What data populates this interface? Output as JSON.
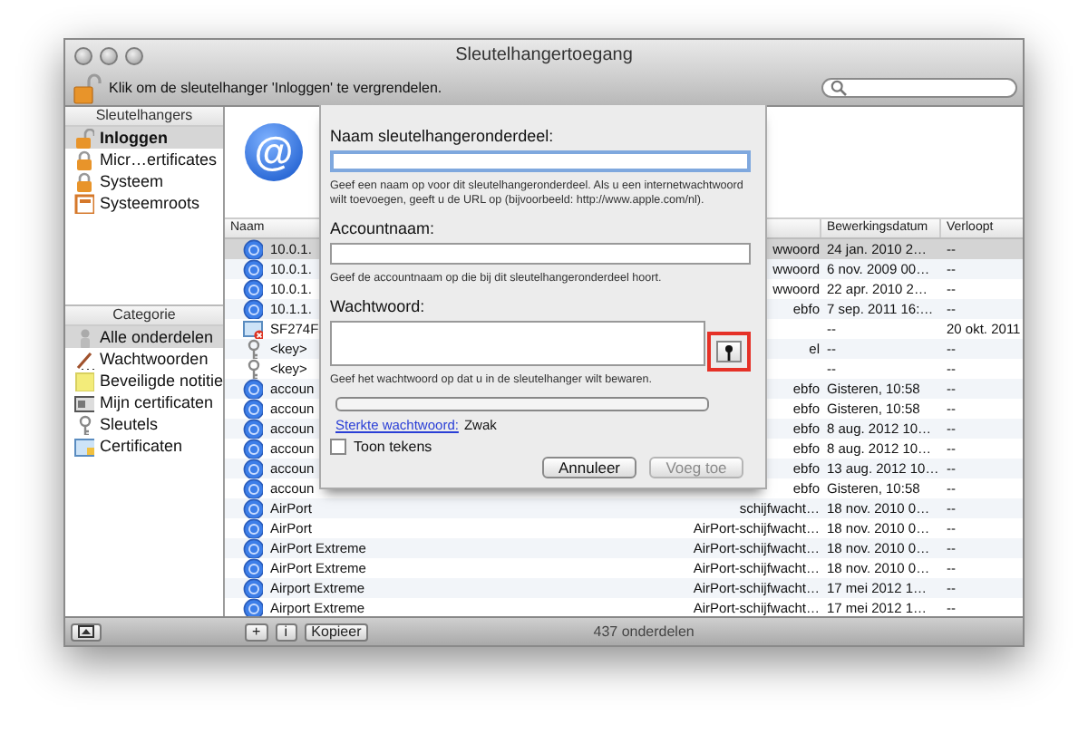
{
  "window": {
    "title": "Sleutelhangertoegang"
  },
  "toolbar": {
    "lock_message": "Klik om de sleutelhanger 'Inloggen' te vergrendelen."
  },
  "sidebar": {
    "keychains": {
      "title": "Sleutelhangers",
      "items": [
        {
          "label": "Inloggen",
          "kind": "lock-open",
          "selected": true
        },
        {
          "label": "Micr…ertificates",
          "kind": "lock",
          "selected": false
        },
        {
          "label": "Systeem",
          "kind": "lock",
          "selected": false
        },
        {
          "label": "Systeemroots",
          "kind": "cabinet",
          "selected": false
        }
      ]
    },
    "categories": {
      "title": "Categorie",
      "items": [
        {
          "label": "Alle onderdelen",
          "kind": "person",
          "selected": true
        },
        {
          "label": "Wachtwoorden",
          "kind": "pencil",
          "selected": false
        },
        {
          "label": "Beveiligde notitie",
          "kind": "note",
          "selected": false
        },
        {
          "label": "Mijn certificaten",
          "kind": "card",
          "selected": false
        },
        {
          "label": "Sleutels",
          "kind": "key",
          "selected": false
        },
        {
          "label": "Certificaten",
          "kind": "certificate",
          "selected": false
        }
      ]
    }
  },
  "info": {
    "glyph": "@"
  },
  "table": {
    "columns": {
      "name": "Naam",
      "modified": "Bewerkingsdatum",
      "expires": "Verloopt"
    },
    "rows": [
      {
        "kind": "globe",
        "name": "10.0.1.",
        "type": "wwoord",
        "modified": "24 jan. 2010 2…",
        "expires": "--",
        "selected": true
      },
      {
        "kind": "globe",
        "name": "10.0.1.",
        "type": "wwoord",
        "modified": "6 nov. 2009 00…",
        "expires": "--",
        "selected": false
      },
      {
        "kind": "globe",
        "name": "10.0.1.",
        "type": "wwoord",
        "modified": "22 apr. 2010 2…",
        "expires": "--",
        "selected": false
      },
      {
        "kind": "globe",
        "name": "10.1.1.",
        "type": "ebfo",
        "modified": "7 sep. 2011 16:…",
        "expires": "--",
        "selected": false
      },
      {
        "kind": "certificate",
        "name": "SF274F",
        "modified": "--",
        "expires": "20 okt. 2011",
        "selected": false
      },
      {
        "kind": "key",
        "name": "<key>",
        "type": "el",
        "modified": "--",
        "expires": "--",
        "selected": false
      },
      {
        "kind": "key",
        "name": "<key>",
        "modified": "--",
        "expires": "--",
        "selected": false
      },
      {
        "kind": "globe",
        "name": "accoun",
        "type": "ebfo",
        "modified": "Gisteren, 10:58",
        "expires": "--",
        "selected": false
      },
      {
        "kind": "globe",
        "name": "accoun",
        "type": "ebfo",
        "modified": "Gisteren, 10:58",
        "expires": "--",
        "selected": false
      },
      {
        "kind": "globe",
        "name": "accoun",
        "type": "ebfo",
        "modified": "8 aug. 2012 10…",
        "expires": "--",
        "selected": false
      },
      {
        "kind": "globe",
        "name": "accoun",
        "type": "ebfo",
        "modified": "8 aug. 2012 10…",
        "expires": "--",
        "selected": false
      },
      {
        "kind": "globe",
        "name": "accoun",
        "type": "ebfo",
        "modified": "13 aug. 2012 10…",
        "expires": "--",
        "selected": false
      },
      {
        "kind": "globe",
        "name": "accoun",
        "type": "ebfo",
        "modified": "Gisteren, 10:58",
        "expires": "--",
        "selected": false
      },
      {
        "kind": "globe",
        "name": "AirPort",
        "type": "schijfwacht…",
        "modified": "18 nov. 2010 0…",
        "expires": "--",
        "selected": false
      },
      {
        "kind": "globe",
        "name": "AirPort",
        "type": "AirPort-schijfwacht…",
        "modified": "18 nov. 2010 0…",
        "expires": "--",
        "selected": false
      },
      {
        "kind": "globe",
        "name": "AirPort Extreme",
        "type": "AirPort-schijfwacht…",
        "modified": "18 nov. 2010 0…",
        "expires": "--",
        "selected": false
      },
      {
        "kind": "globe",
        "name": "AirPort Extreme",
        "type": "AirPort-schijfwacht…",
        "modified": "18 nov. 2010 0…",
        "expires": "--",
        "selected": false
      },
      {
        "kind": "globe",
        "name": "Airport Extreme",
        "type": "AirPort-schijfwacht…",
        "modified": "17 mei 2012 1…",
        "expires": "--",
        "selected": false
      },
      {
        "kind": "globe",
        "name": "Airport Extreme",
        "type": "AirPort-schijfwacht…",
        "modified": "17 mei 2012 1…",
        "expires": "--",
        "selected": false
      }
    ]
  },
  "sheet": {
    "name_label": "Naam sleutelhangeronderdeel:",
    "name_help": "Geef een naam op voor dit sleutelhangeronderdeel. Als u een internetwachtwoord wilt toevoegen, geeft u de URL op (bijvoorbeeld: http://www.apple.com/nl).",
    "account_label": "Accountnaam:",
    "account_help": "Geef de accountnaam op die bij dit sleutelhangeronderdeel hoort.",
    "password_label": "Wachtwoord:",
    "password_help": "Geef het wachtwoord op dat u in de sleutelhanger wilt bewaren.",
    "key_button": {
      "highlighted": true
    },
    "strength": {
      "level": 0,
      "link": "Sterkte wachtwoord:",
      "value": "Zwak"
    },
    "show_chars": {
      "label": "Toon tekens",
      "checked": false
    },
    "buttons": [
      {
        "label": "Annuleer",
        "disabled": false
      },
      {
        "label": "Voeg toe",
        "disabled": true
      }
    ]
  },
  "status_bar": {
    "buttons": [
      "+",
      "i",
      "Kopieer"
    ],
    "count": "437 onderdelen"
  }
}
